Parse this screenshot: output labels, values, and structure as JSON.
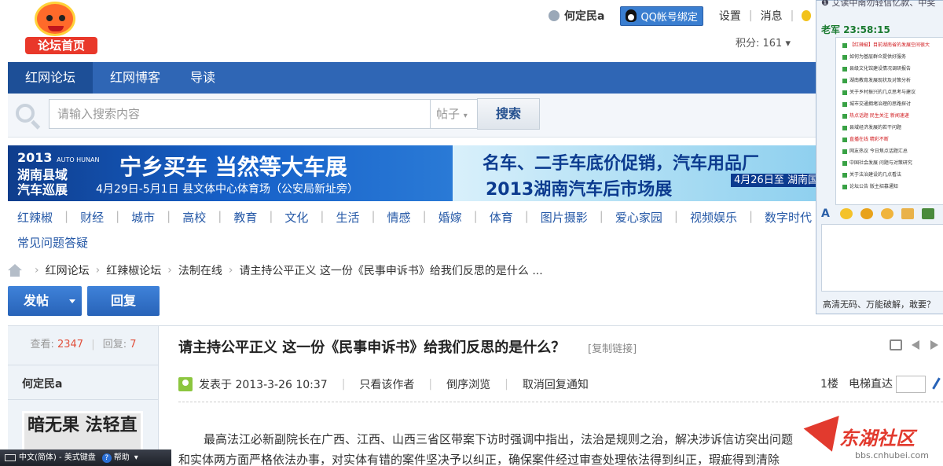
{
  "logo": {
    "label": "论坛首页"
  },
  "userbar": {
    "username": "何定民a",
    "qq_bind": "QQ帐号绑定",
    "settings": "设置",
    "messages": "消息",
    "points": "积分: 161"
  },
  "nav": {
    "tabs": [
      "红网论坛",
      "红网博客",
      "导读"
    ]
  },
  "search": {
    "placeholder": "请输入搜索内容",
    "type": "帖子",
    "button": "搜索"
  },
  "banner": {
    "left_year": "2013",
    "left_year_tag": "AUTO HUNAN",
    "left_line2": "湖南县域",
    "left_line3": "汽车巡展",
    "left_main": "宁乡买车 当然等大车展",
    "left_sub": "4月29日-5月1日  县文体中心体育场（公安局新址旁）",
    "right_line1": "名车、二手车底价促销，汽车用品厂",
    "right_line2": "2013湖南汽车后市场展",
    "right_line3": "4月26日至 湖南国际会"
  },
  "categories": [
    "红辣椒",
    "财经",
    "城市",
    "高校",
    "教育",
    "文化",
    "生活",
    "情感",
    "婚嫁",
    "体育",
    "图片摄影",
    "爱心家园",
    "视频娱乐",
    "数字时代"
  ],
  "faq": "常见问题答疑",
  "breadcrumb": [
    "红网论坛",
    "红辣椒论坛",
    "法制在线",
    "请主持公平正义 这一份《民事申诉书》给我们反思的是什么 ..."
  ],
  "actions": {
    "post": "发帖",
    "reply": "回复"
  },
  "thread": {
    "views_label": "查看:",
    "views": "2347",
    "replies_label": "回复:",
    "replies": "7",
    "author": "何定民a",
    "avatar_text": "暗无果 法轻直",
    "title": "请主持公平正义 这一份《民事申诉书》给我们反思的是什么？",
    "copy_link": "[复制链接]",
    "posted_at": "发表于 2013-3-26 10:37",
    "only_author": "只看该作者",
    "reverse": "倒序浏览",
    "cancel_notify": "取消回复通知",
    "floor": "1楼",
    "goto_label": "电梯直达",
    "body_line1": "最高法江必新副院长在广西、江西、山西三省区带案下访时强调中指出，法治是规则之治，解决涉诉信访突出问题",
    "body_line2": "和实体两方面严格依法办事，对实体有错的案件坚决予以纠正，确保案件经过审查处理依法得到纠正，瑕疵得到清除"
  },
  "watermark": {
    "name": "东湖社区",
    "url": "bbs.cnhubei.com"
  },
  "chat": {
    "top_line": "❶ 艾读中南勿轻信忆款、中奖",
    "sender": "老军  23:58:15",
    "rows": [
      {
        "text": "【红辣椒】目前湖南省的发展空间很大",
        "red": true
      },
      {
        "text": "如何为基层群众提供好服务",
        "red": false
      },
      {
        "text": "县级文化馆建设情况调研报告",
        "red": false
      },
      {
        "text": "湖南教育发展现状及对策分析",
        "red": false
      },
      {
        "text": "关于乡村振兴的几点思考与建议",
        "red": false
      },
      {
        "text": "城市交通拥堵治理的思路探讨",
        "red": false
      },
      {
        "text": "热点话题 民生关注 新闻速递",
        "red": true
      },
      {
        "text": "县域经济发展的若干问题",
        "red": false
      },
      {
        "text": "直播在线 精彩不断",
        "red": true
      },
      {
        "text": "网友热议 今日焦点话题汇总",
        "red": false
      },
      {
        "text": "中国社会发展 问题与对策研究",
        "red": false
      },
      {
        "text": "关于法治建设的几点看法",
        "red": false
      },
      {
        "text": "论坛公告 版主招募通知",
        "red": false
      }
    ],
    "promo": "高清无码、万能破解，敢要？"
  },
  "ime": {
    "lang": "中文(简体) - 美式键盘",
    "help": "帮助"
  }
}
